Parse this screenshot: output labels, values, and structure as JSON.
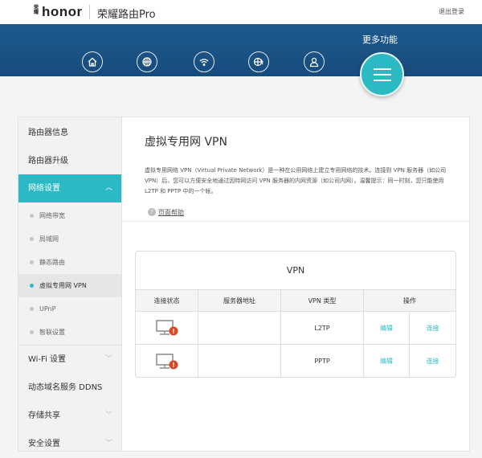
{
  "header": {
    "logo": "honor",
    "logo_small": "荣耀",
    "product": "荣耀路由Pro",
    "logout": "退出登录"
  },
  "nav": {
    "icons": [
      "home-icon",
      "internet-icon",
      "wifi-icon",
      "network-settings-icon",
      "user-icon"
    ],
    "more_label": "更多功能"
  },
  "sidebar": {
    "items": [
      {
        "label": "路由器信息"
      },
      {
        "label": "路由器升级"
      },
      {
        "label": "网络设置",
        "expanded": true
      }
    ],
    "sub_items": [
      {
        "label": "网络带宽"
      },
      {
        "label": "局域网"
      },
      {
        "label": "静态路由"
      },
      {
        "label": "虚拟专用网 VPN",
        "active": true
      },
      {
        "label": "UPnP"
      },
      {
        "label": "智联设置"
      }
    ],
    "bottom_items": [
      {
        "label": "Wi-Fi 设置"
      },
      {
        "label": "动态域名服务 DDNS"
      },
      {
        "label": "存储共享"
      },
      {
        "label": "安全设置"
      }
    ]
  },
  "main": {
    "title": "虚拟专用网 VPN",
    "description": "虚拟专用网络 VPN（Virtual Private Network）是一种在公用网络上建立专用网络的技术。连接到 VPN 服务器（如公司 VPN）后，您可以方便安全地通过因特网访问 VPN 服务器的内网资源（如公司内网）。温馨提示：同一时刻，您只能使用 L2TP 和 PPTP 中的一个帐。",
    "help": "页面帮助",
    "table": {
      "title": "VPN",
      "headers": [
        "连接状态",
        "服务器地址",
        "VPN 类型",
        "操作"
      ],
      "rows": [
        {
          "server": "",
          "type": "L2TP",
          "edit": "编辑",
          "connect": "连接"
        },
        {
          "server": "",
          "type": "PPTP",
          "edit": "编辑",
          "connect": "连接"
        }
      ]
    }
  },
  "colors": {
    "accent": "#2bbac3",
    "band": "#1d5a8e",
    "warn": "#e0441e"
  }
}
